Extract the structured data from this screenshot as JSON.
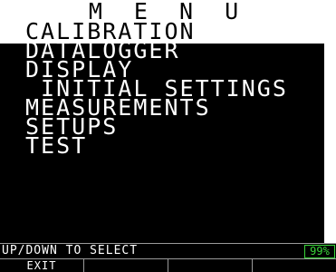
{
  "menu": {
    "title": "M E N U",
    "items": [
      {
        "label": "CALIBRATION",
        "selected": true
      },
      {
        "label": "DATALOGGER",
        "selected": false
      },
      {
        "label": "DISPLAY",
        "selected": false
      },
      {
        "label": " INITIAL SETTINGS",
        "selected": false
      },
      {
        "label": "MEASUREMENTS",
        "selected": false
      },
      {
        "label": "SETUPS",
        "selected": false
      },
      {
        "label": "TEST",
        "selected": false
      }
    ]
  },
  "status": {
    "hint": "UP/DOWN TO SELECT",
    "battery": "99%",
    "battery_level": 0.99
  },
  "softkeys": [
    "EXIT",
    "",
    "",
    ""
  ],
  "colors": {
    "background": "#000000",
    "text": "#ffffff",
    "highlight": "#ffffff",
    "battery": "#39d439"
  }
}
